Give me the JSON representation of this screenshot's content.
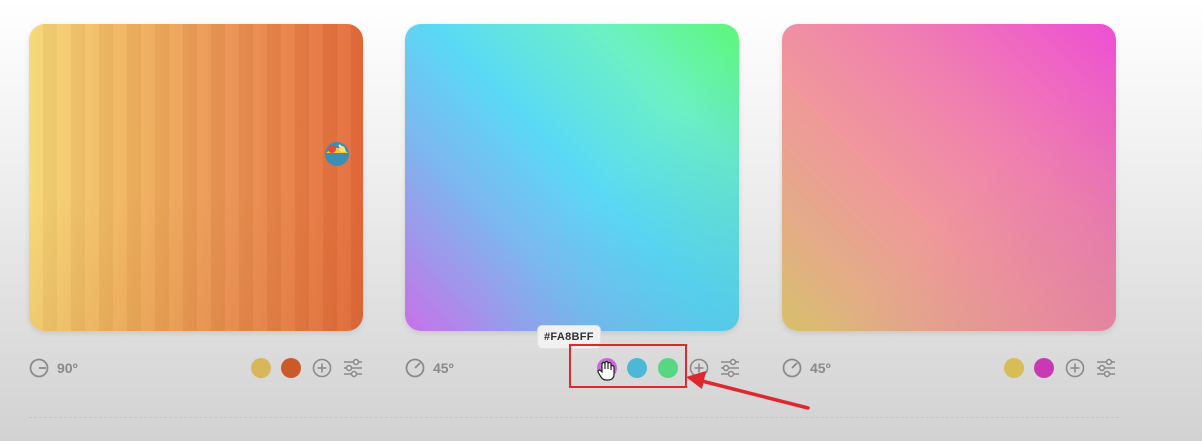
{
  "cards": [
    {
      "angle": "90º",
      "stops": [
        "#F7D777",
        "#E56A3A"
      ],
      "swatches": [
        "#D8B65A",
        "#CB5A2A"
      ]
    },
    {
      "angle": "45º",
      "stops": [
        "#C772E8",
        "#5AD9F6",
        "#5DF77A"
      ],
      "swatches": [
        "#C86AD6",
        "#4DB7D6",
        "#59D684"
      ]
    },
    {
      "angle": "45º",
      "stops": [
        "#D7C06B",
        "#EE4FD4"
      ],
      "swatches": [
        "#D8BC58",
        "#C83AB4"
      ]
    }
  ],
  "tooltip": {
    "text": "#FA8BFF"
  },
  "annotation": {
    "color": "#E0262F"
  }
}
